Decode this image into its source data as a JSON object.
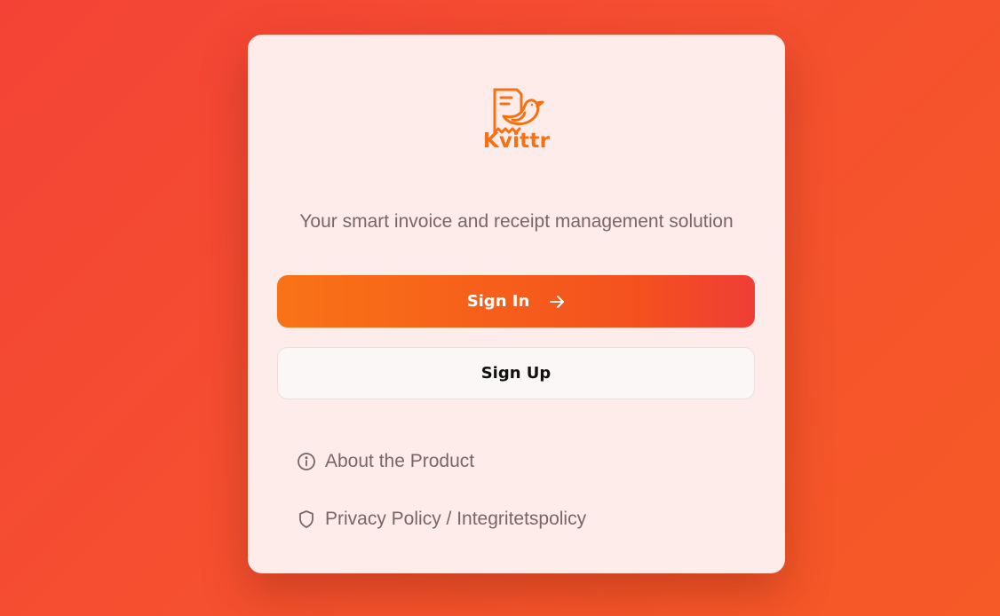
{
  "brand": {
    "name": "Kvittr",
    "color": "#f57114",
    "logo_icon": "receipt-bird-logo-icon"
  },
  "tagline": "Your smart invoice and receipt management solution",
  "actions": {
    "sign_in_label": "Sign In",
    "sign_in_icon": "arrow-right-icon",
    "sign_up_label": "Sign Up"
  },
  "links": {
    "about": {
      "label": "About the Product",
      "icon": "info-icon"
    },
    "privacy": {
      "label": "Privacy Policy / Integritetspolicy",
      "icon": "shield-icon"
    }
  },
  "colors": {
    "background": "#f44336",
    "card": "#fdecea",
    "primary_gradient_start": "#f97316",
    "primary_gradient_end": "#ef3e36",
    "muted_text": "#7a6663"
  }
}
